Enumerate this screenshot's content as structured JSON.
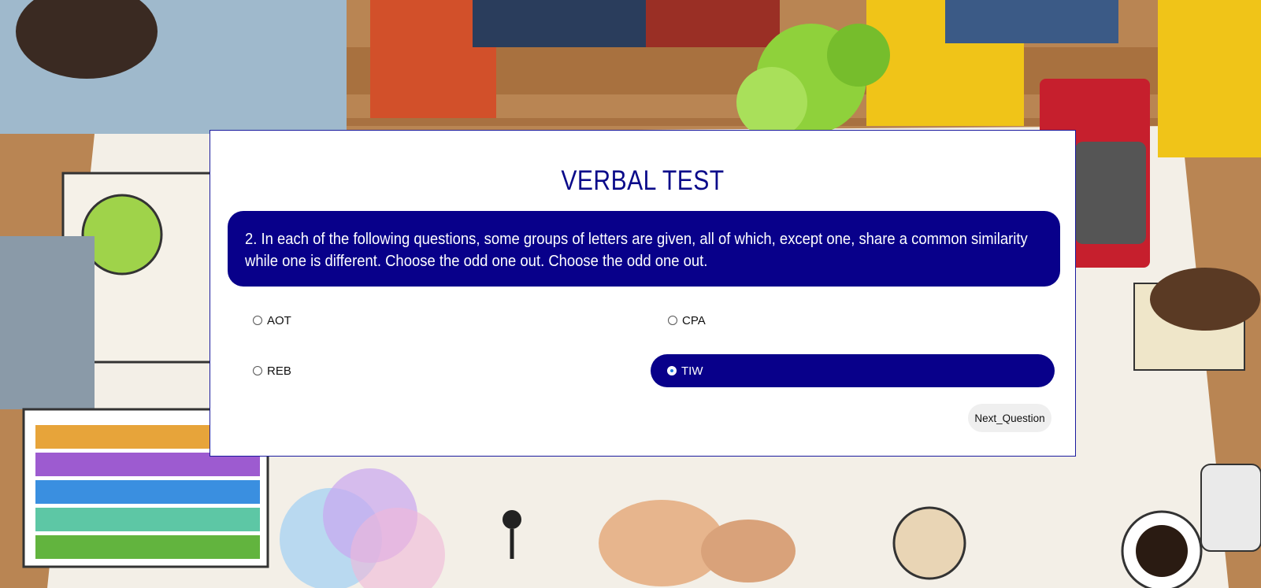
{
  "quiz": {
    "title": "VERBAL TEST",
    "question": "2. In each of the following questions, some groups of letters are given, all of which, except one, share a common similarity while one is different. Choose the odd one out. Choose the odd one out.",
    "options": [
      {
        "label": "AOT",
        "selected": false
      },
      {
        "label": "CPA",
        "selected": false
      },
      {
        "label": "REB",
        "selected": false
      },
      {
        "label": "TIW",
        "selected": true
      }
    ],
    "next_label": "Next_Question"
  },
  "colors": {
    "accent": "#08008a",
    "title": "#0b0b8a",
    "card_border": "#1b1b9e",
    "button_bg": "#efefef"
  }
}
